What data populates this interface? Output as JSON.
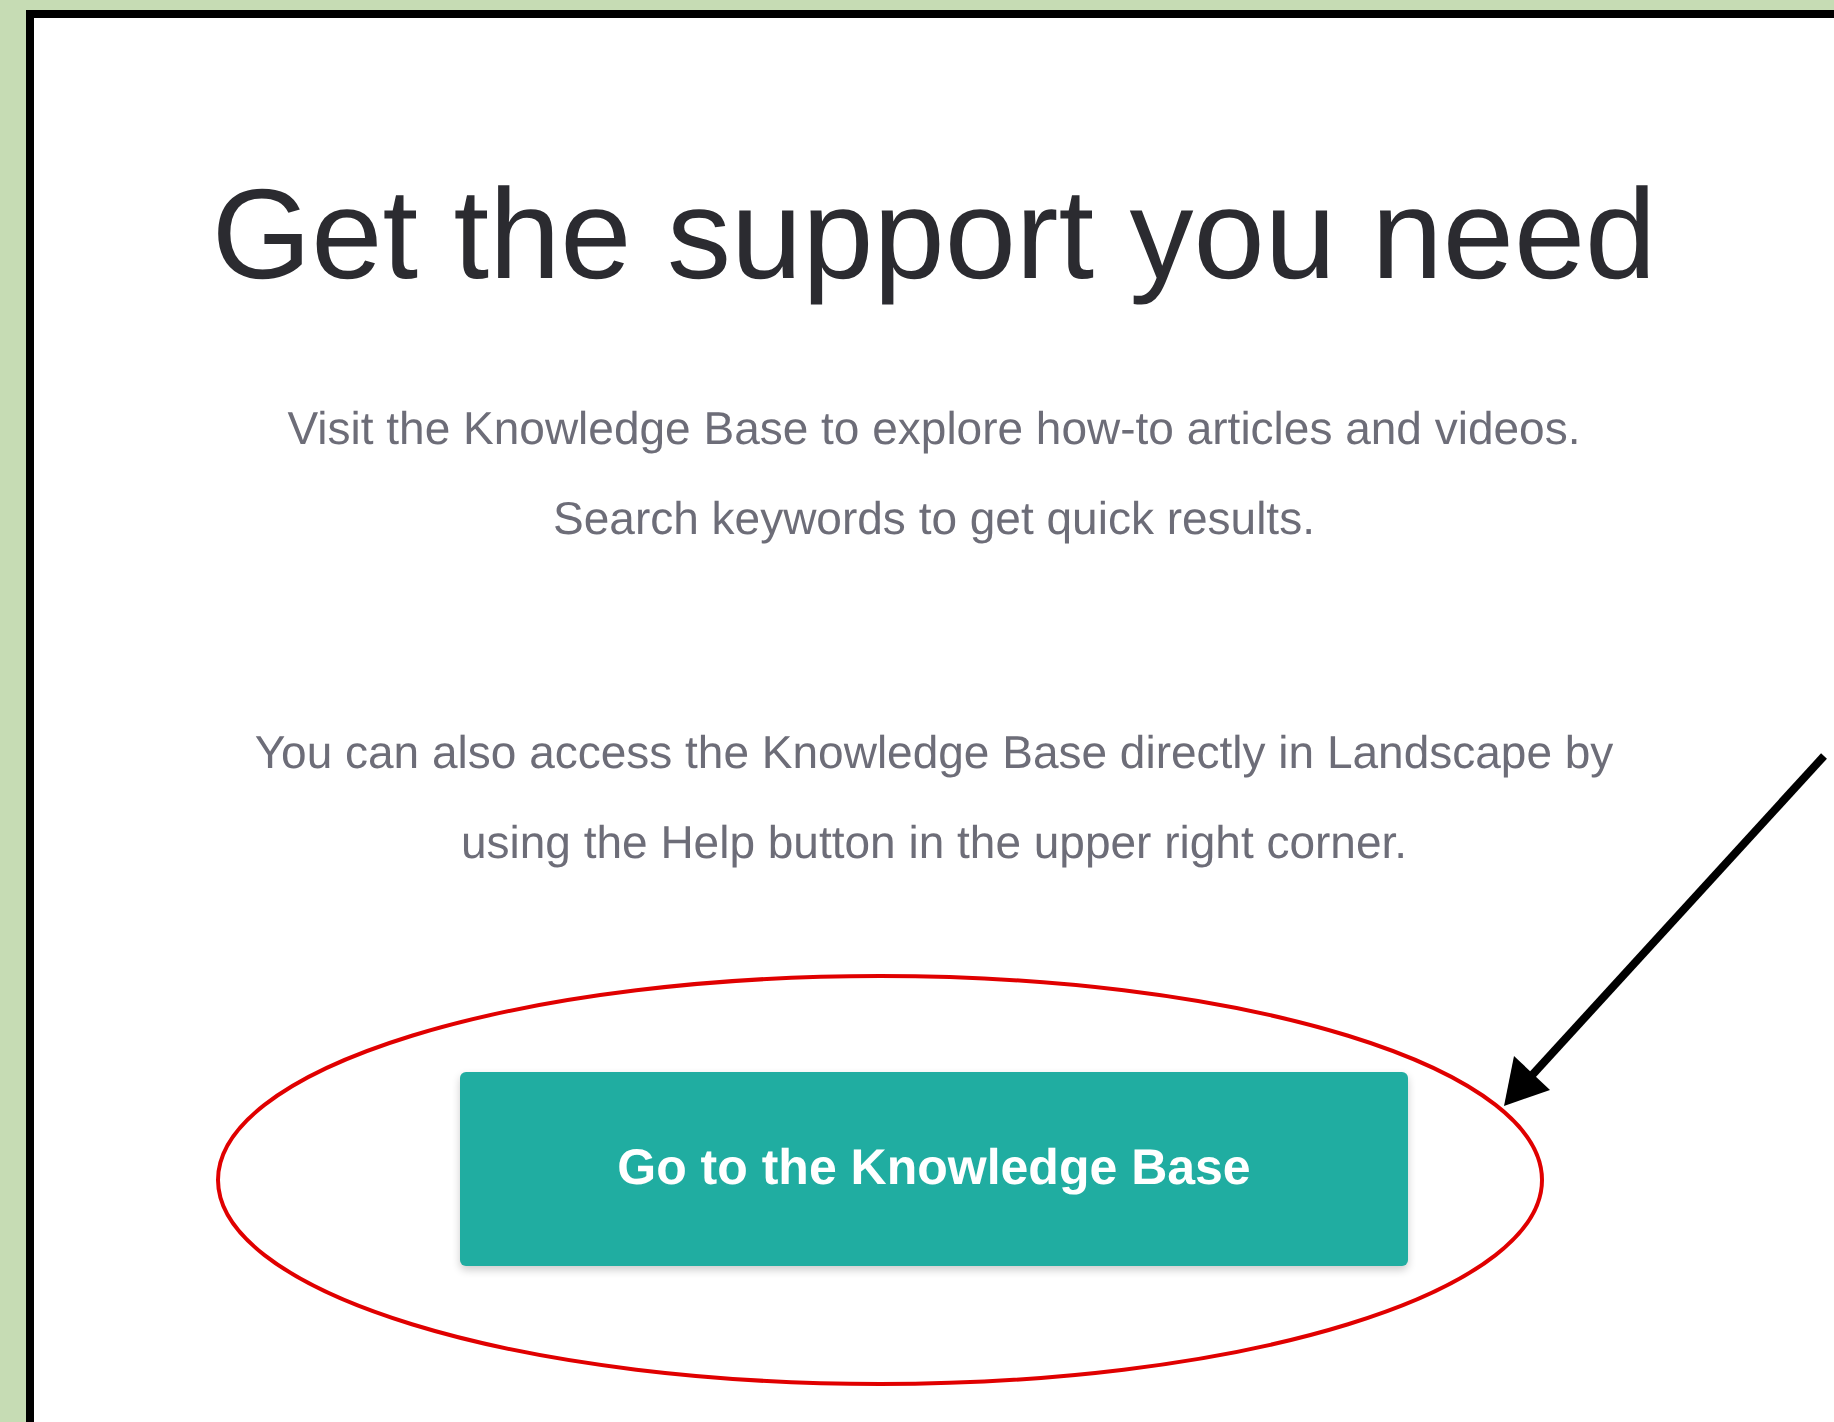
{
  "heading": "Get the support you need",
  "paragraphs": [
    {
      "lines": [
        "Visit the Knowledge Base to explore how-to articles and videos.",
        "Search keywords to get quick results."
      ]
    },
    {
      "lines": [
        "You can also access the Knowledge Base directly in Landscape by",
        "using the Help button in the upper right corner."
      ]
    }
  ],
  "button": {
    "label": "Go to the Knowledge Base"
  }
}
